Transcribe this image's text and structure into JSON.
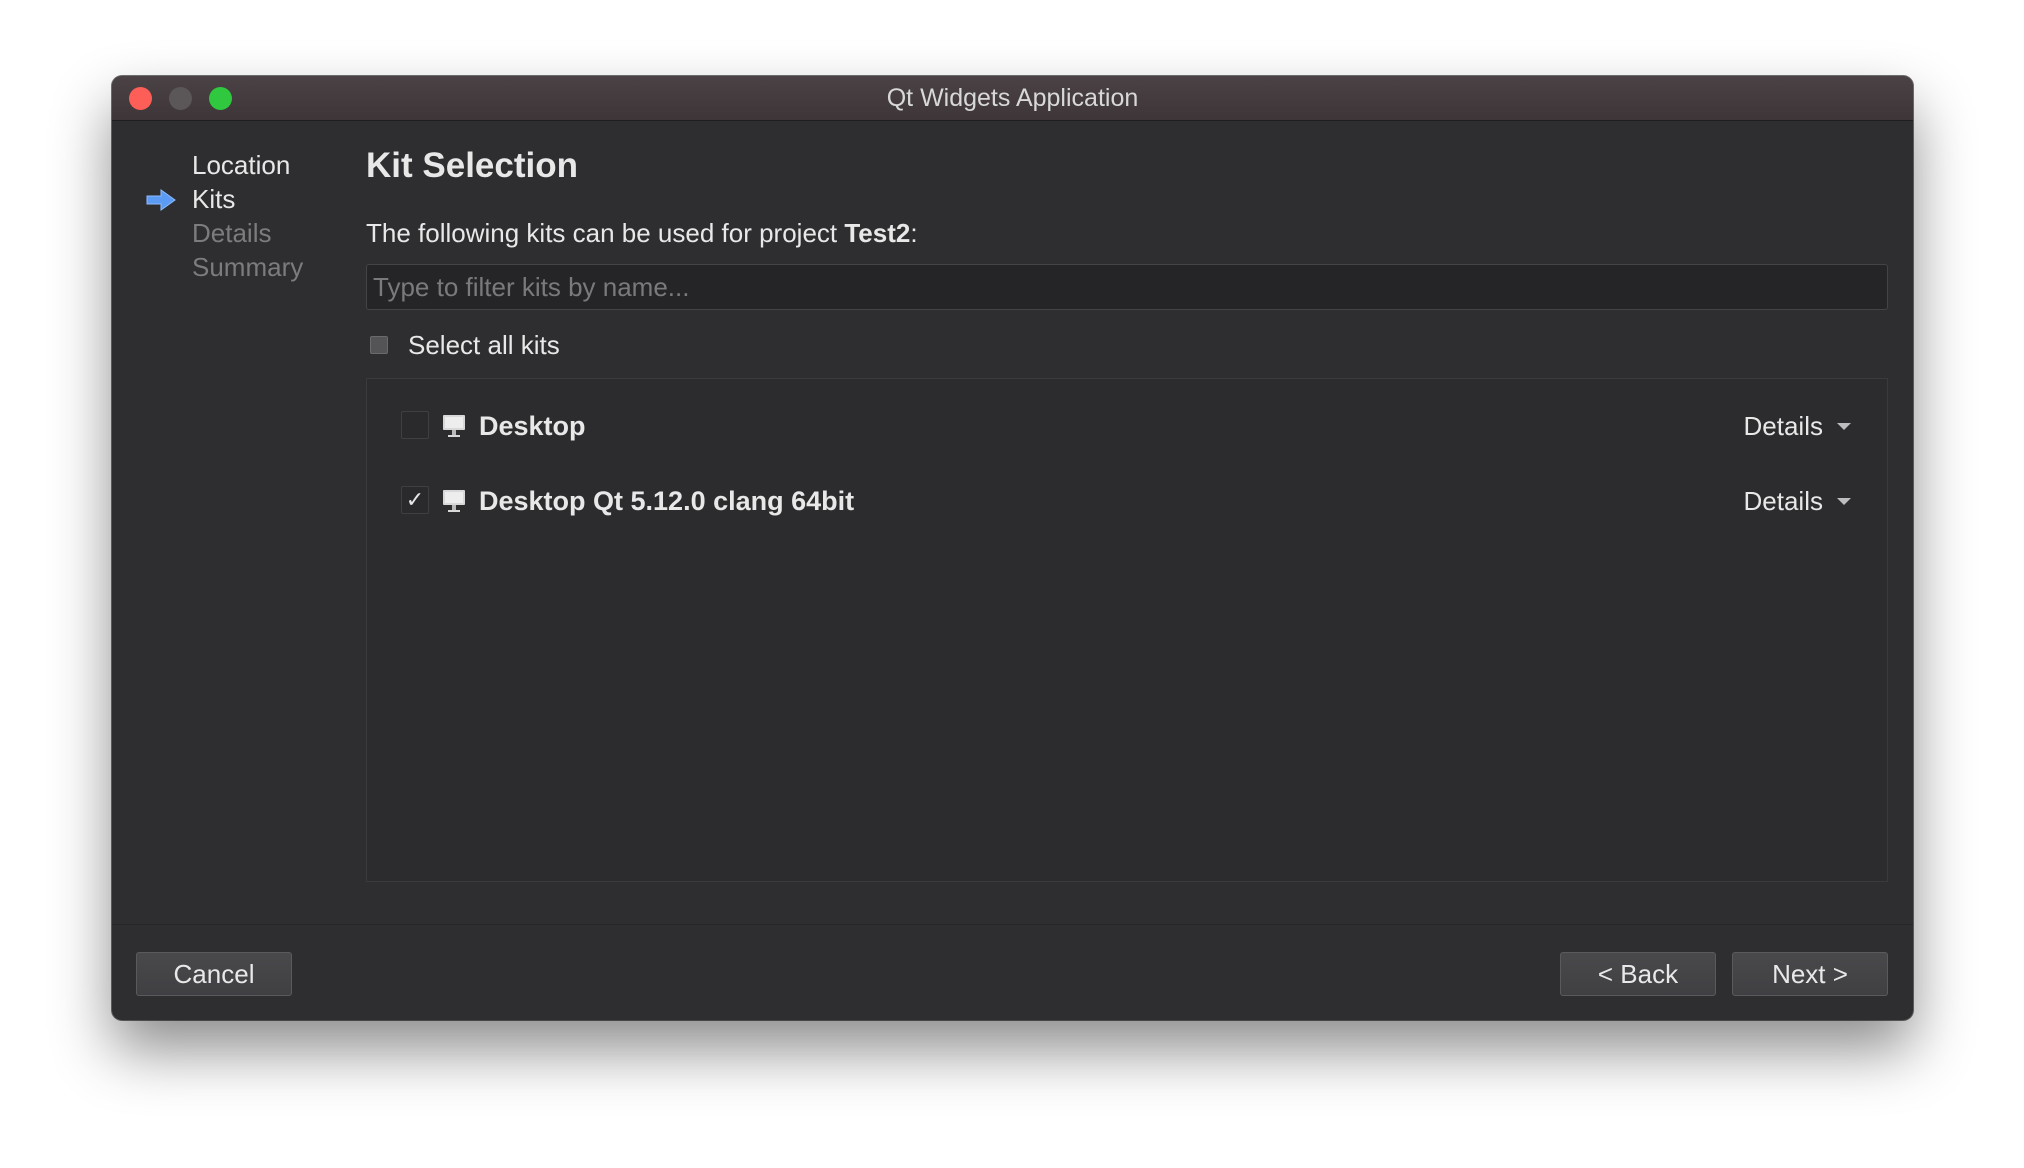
{
  "window": {
    "title": "Qt Widgets Application"
  },
  "sidebar": {
    "steps": [
      {
        "label": "Location",
        "state": "done"
      },
      {
        "label": "Kits",
        "state": "current"
      },
      {
        "label": "Details",
        "state": "future"
      },
      {
        "label": "Summary",
        "state": "future"
      }
    ],
    "current_icon": "arrow-right-icon",
    "current_icon_color": "#5b9bf3"
  },
  "main": {
    "title": "Kit Selection",
    "intro_prefix": "The following kits can be used for project ",
    "project_name": "Test2",
    "intro_suffix": ":",
    "filter_placeholder": "Type to filter kits by name...",
    "filter_value": "",
    "select_all_label": "Select all kits",
    "select_all_checked": false,
    "kits": [
      {
        "name": "Desktop",
        "checked": false,
        "icon": "monitor-icon",
        "details_label": "Details"
      },
      {
        "name": "Desktop Qt 5.12.0 clang 64bit",
        "checked": true,
        "icon": "monitor-icon",
        "details_label": "Details"
      }
    ]
  },
  "footer": {
    "cancel_label": "Cancel",
    "back_label": "< Back",
    "next_label": "Next >"
  },
  "colors": {
    "window_bg": "#2e2e30",
    "text": "#e8e8e8",
    "muted_text": "#7c7c7e",
    "close": "#fd5e57",
    "minimize": "#5b5758",
    "maximize": "#2fc83f"
  }
}
